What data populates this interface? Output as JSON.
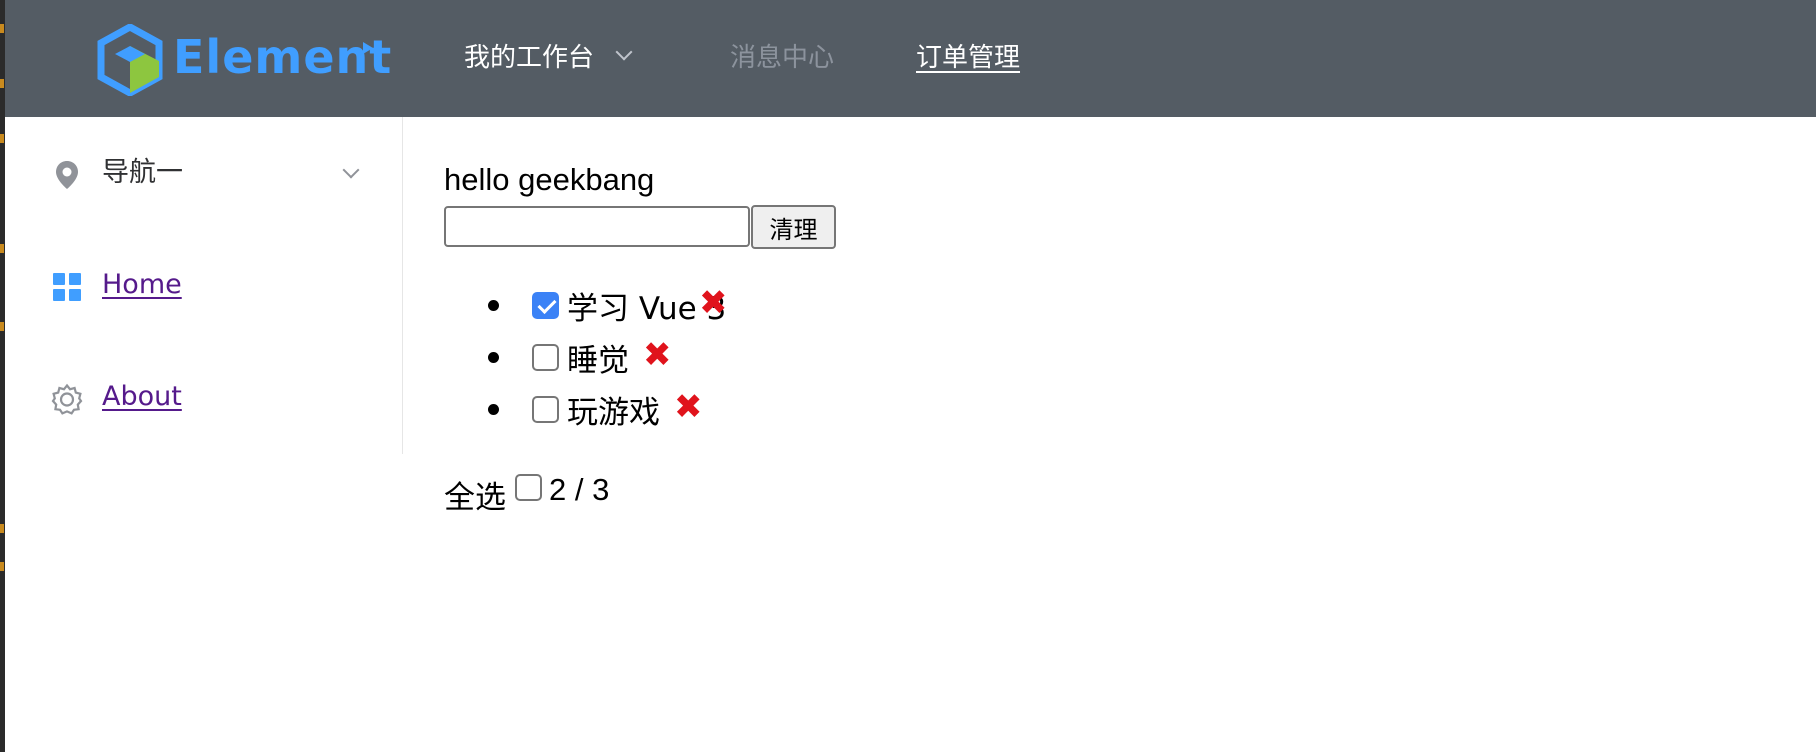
{
  "header": {
    "logo_text": "Element",
    "nav": [
      {
        "label": "我的工作台"
      },
      {
        "label": "消息中心"
      },
      {
        "label": "订单管理"
      }
    ]
  },
  "sidebar": {
    "items": [
      {
        "label": "导航一",
        "icon": "location-icon"
      },
      {
        "label": " Home",
        "icon": "grid-icon"
      },
      {
        "label": "About",
        "icon": "gear-icon"
      }
    ]
  },
  "main": {
    "hello": "hello geekbang",
    "input_value": "",
    "clear_label": "清理",
    "todos": [
      {
        "text": "学习 Vue 3",
        "done": true,
        "delete_symbol": "✖"
      },
      {
        "text": "睡觉",
        "done": false,
        "delete_symbol": "✖"
      },
      {
        "text": "玩游戏",
        "done": false,
        "delete_symbol": "✖"
      }
    ],
    "select_all_label": "全选",
    "count_text": "2 / 3"
  },
  "colors": {
    "header_bg": "#545c64",
    "brand": "#409eff",
    "delete_red": "#e0131c",
    "link_visited": "#551a8b"
  }
}
